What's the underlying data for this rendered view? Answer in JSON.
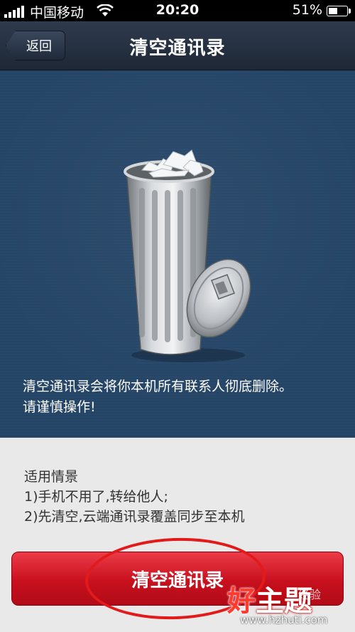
{
  "status_bar": {
    "carrier": "中国移动",
    "time": "20:20",
    "battery_text": "51%",
    "battery_level": 0.51
  },
  "nav": {
    "back_label": "返回",
    "title": "清空通讯录"
  },
  "hero": {
    "icon": "trash-can-icon",
    "warning_line1": "清空通讯录会将你本机所有联系人彻底删除。",
    "warning_line2": "请谨慎操作!"
  },
  "info": {
    "heading": "适用情景",
    "item1": "1)手机不用了,转给他人;",
    "item2": "2)先清空,云端通讯录覆盖同步至本机"
  },
  "action": {
    "clear_label": "清空通讯录"
  },
  "watermark": {
    "logo_part1": "好",
    "logo_part2": "主题",
    "url": "www.hzhuti.com",
    "side_text": "经验"
  },
  "colors": {
    "hero_bg": "#244466",
    "button_red": "#c8101e",
    "annotation_red": "#e21a1a"
  }
}
